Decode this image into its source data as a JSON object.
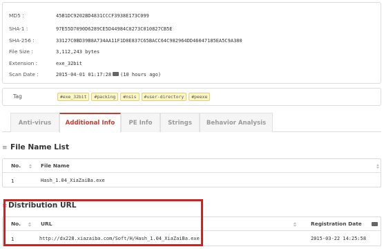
{
  "file_info": {
    "rows": [
      {
        "label": "MD5 :",
        "value": "45B1DC9202BD4831CCCF3938E173C099"
      },
      {
        "label": "SHA-1 :",
        "value": "97E55D7090D6289CE5D44984C0273C010827CB5E"
      },
      {
        "label": "SHA-256 :",
        "value": "33127C0BD39B8A734AA11F1D8E837C65BACC64C982964DD46047185EA5C9A380"
      },
      {
        "label": "File Size :",
        "value": "3,112,243 bytes"
      },
      {
        "label": "Extension :",
        "value": "exe_32bit"
      }
    ],
    "scan_date": {
      "label": "Scan Date :",
      "date": "2015-04-01 01:17:28",
      "relative": "(10 hours ago)",
      "icon": "calendar-icon"
    }
  },
  "tags": {
    "label": "Tag",
    "items": [
      "#exe_32bit",
      "#packing",
      "#nsis",
      "#user-directory",
      "#peexe"
    ]
  },
  "tabs": {
    "active_index": 1,
    "items": [
      "Anti-virus",
      "Additional Info",
      "PE Info",
      "Strings",
      "Behavior Analysis"
    ]
  },
  "file_name_list": {
    "heading": "File Name List",
    "columns": {
      "no": "No.",
      "file_name": "File Name"
    },
    "rows": [
      {
        "no": "1",
        "file_name": "Hash_1.04_XiaZaiBa.exe"
      }
    ]
  },
  "distribution_url": {
    "heading": "Distribution URL",
    "columns": {
      "no": "No.",
      "url": "URL",
      "date": "Registration Date"
    },
    "rows": [
      {
        "no": "1",
        "url": "http://dx228.xiazaiba.com/Soft/H/Hash_1.04_XiaZaiBa.exe",
        "date": "2015-03-22 14:25:58"
      }
    ]
  },
  "colors": {
    "accent": "#cc3a2f",
    "highlight": "#d21f1f",
    "tag_bg": "#fcf5c8"
  }
}
